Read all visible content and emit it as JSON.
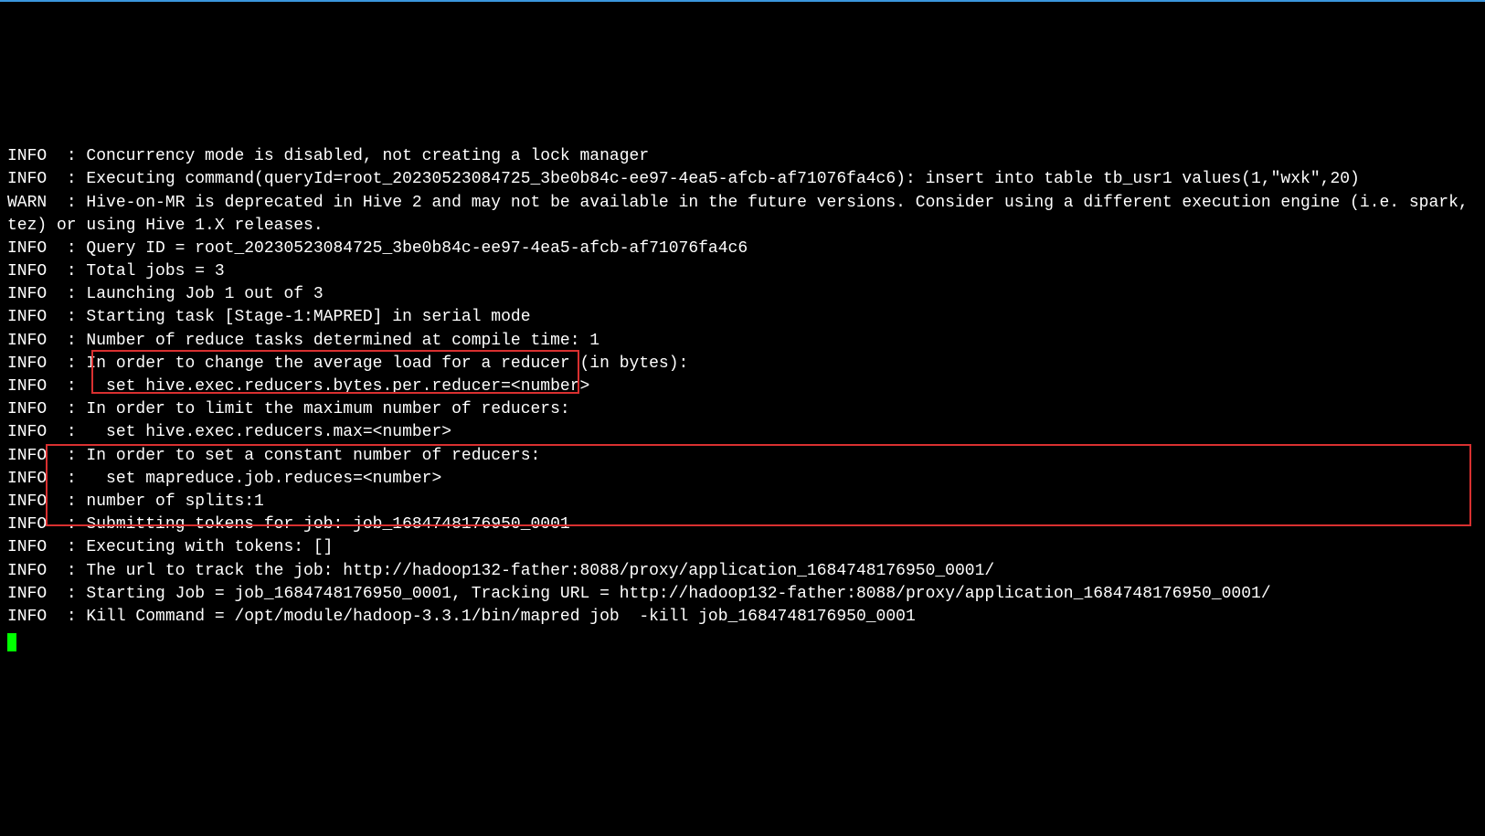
{
  "lines": [
    {
      "level": "INFO ",
      "msg": " : Concurrency mode is disabled, not creating a lock manager"
    },
    {
      "level": "INFO ",
      "msg": " : Executing command(queryId=root_20230523084725_3be0b84c-ee97-4ea5-afcb-af71076fa4c6): insert into table tb_usr1 values(1,\"wxk\",20)"
    },
    {
      "level": "WARN ",
      "msg": " : Hive-on-MR is deprecated in Hive 2 and may not be available in the future versions. Consider using a different execution engine (i.e. spark, tez) or using Hive 1.X releases."
    },
    {
      "level": "INFO ",
      "msg": " : Query ID = root_20230523084725_3be0b84c-ee97-4ea5-afcb-af71076fa4c6"
    },
    {
      "level": "INFO ",
      "msg": " : Total jobs = 3"
    },
    {
      "level": "INFO ",
      "msg": " : Launching Job 1 out of 3"
    },
    {
      "level": "INFO ",
      "msg": " : Starting task [Stage-1:MAPRED] in serial mode"
    },
    {
      "level": "INFO ",
      "msg": " : Number of reduce tasks determined at compile time: 1"
    },
    {
      "level": "INFO ",
      "msg": " : In order to change the average load for a reducer (in bytes):"
    },
    {
      "level": "INFO ",
      "msg": " :   set hive.exec.reducers.bytes.per.reducer=<number>"
    },
    {
      "level": "INFO ",
      "msg": " : In order to limit the maximum number of reducers:"
    },
    {
      "level": "INFO ",
      "msg": " :   set hive.exec.reducers.max=<number>"
    },
    {
      "level": "INFO ",
      "msg": " : In order to set a constant number of reducers:"
    },
    {
      "level": "INFO ",
      "msg": " :   set mapreduce.job.reduces=<number>"
    },
    {
      "level": "INFO ",
      "msg": " : number of splits:1"
    },
    {
      "level": "INFO ",
      "msg": " : Submitting tokens for job: job_1684748176950_0001"
    },
    {
      "level": "INFO ",
      "msg": " : Executing with tokens: []"
    },
    {
      "level": "INFO ",
      "msg": " : The url to track the job: http://hadoop132-father:8088/proxy/application_1684748176950_0001/"
    },
    {
      "level": "INFO ",
      "msg": " : Starting Job = job_1684748176950_0001, Tracking URL = http://hadoop132-father:8088/proxy/application_1684748176950_0001/"
    },
    {
      "level": "INFO ",
      "msg": " : Kill Command = /opt/module/hadoop-3.3.1/bin/mapred job  -kill job_1684748176950_0001"
    }
  ]
}
